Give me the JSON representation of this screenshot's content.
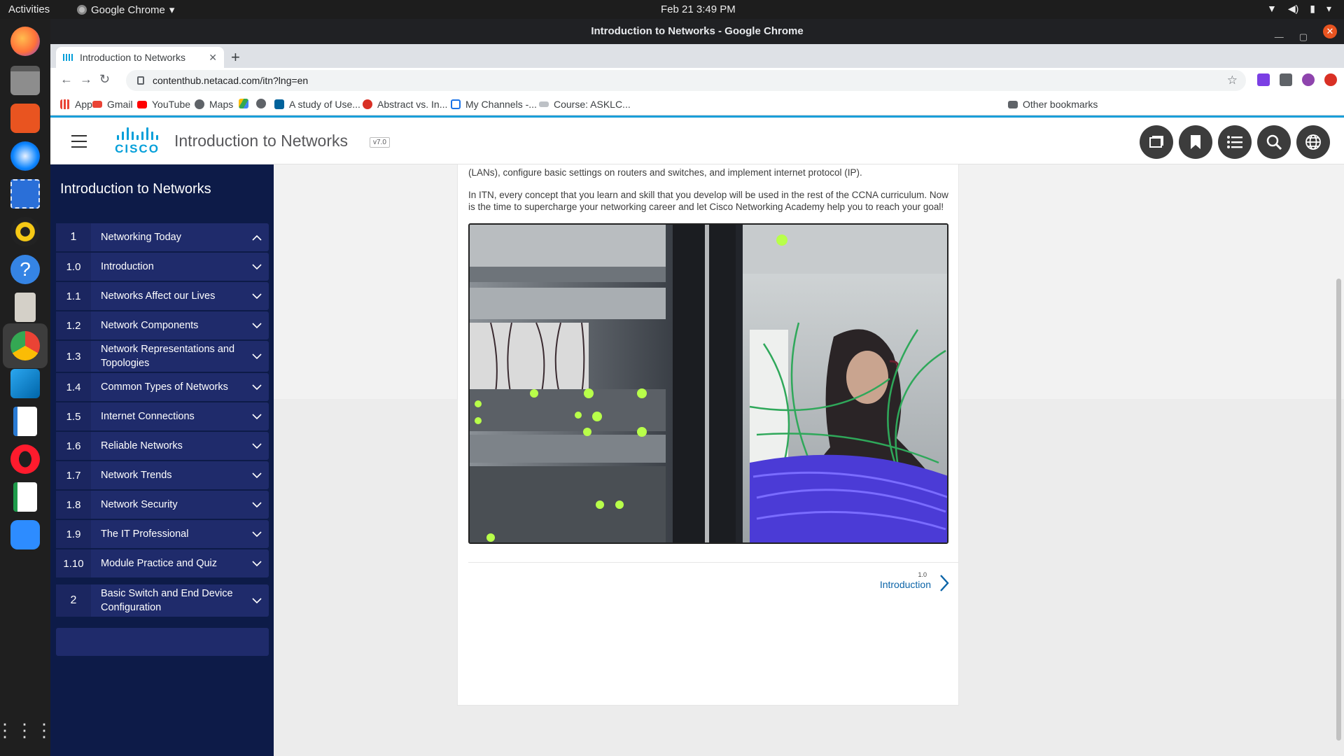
{
  "system": {
    "activities": "Activities",
    "app_menu": "Google Chrome",
    "clock": "Feb 21  3:49 PM"
  },
  "window": {
    "title": "Introduction to Networks - Google Chrome"
  },
  "browser": {
    "tab_title": "Introduction to Networks",
    "url": "contenthub.netacad.com/itn?lng=en",
    "bookmarks": [
      {
        "label": "Apps",
        "icon": "apps-grid-icon",
        "color": "#4285f4"
      },
      {
        "label": "Gmail",
        "icon": "gmail-icon",
        "color": "#ea4335"
      },
      {
        "label": "YouTube",
        "icon": "youtube-icon",
        "color": "#ff0000"
      },
      {
        "label": "Maps",
        "icon": "maps-icon",
        "color": "#5f6368"
      },
      {
        "label": "A study of Use...",
        "icon": "ieee-icon",
        "color": "#00629b"
      },
      {
        "label": "Abstract vs. In...",
        "icon": "scissors-icon",
        "color": "#d93025"
      },
      {
        "label": "My Channels -...",
        "icon": "chat-icon",
        "color": "#1a73e8"
      },
      {
        "label": "Course: ASKLC...",
        "icon": "course-icon",
        "color": "#9aa0a6"
      }
    ],
    "other_bookmarks": "Other bookmarks"
  },
  "site": {
    "course_title": "Introduction to Networks",
    "version": "v7.0",
    "logo_text": "CISCO",
    "header_icons": [
      "window-icon",
      "bookmark-icon",
      "list-icon",
      "search-icon",
      "globe-icon"
    ]
  },
  "sidebar": {
    "title": "Introduction to Networks",
    "items": [
      {
        "num": "1",
        "label": "Networking Today",
        "expanded": true
      },
      {
        "num": "1.0",
        "label": "Introduction"
      },
      {
        "num": "1.1",
        "label": "Networks Affect our Lives"
      },
      {
        "num": "1.2",
        "label": "Network Components"
      },
      {
        "num": "1.3",
        "label": "Network Representations and Topologies"
      },
      {
        "num": "1.4",
        "label": "Common Types of Networks"
      },
      {
        "num": "1.5",
        "label": "Internet Connections"
      },
      {
        "num": "1.6",
        "label": "Reliable Networks"
      },
      {
        "num": "1.7",
        "label": "Network Trends"
      },
      {
        "num": "1.8",
        "label": "Network Security"
      },
      {
        "num": "1.9",
        "label": "The IT Professional"
      },
      {
        "num": "1.10",
        "label": "Module Practice and Quiz"
      },
      {
        "num": "2",
        "label": "Basic Switch and End Device Configuration"
      }
    ]
  },
  "content": {
    "para1": "(LANs), configure basic settings on routers and switches, and implement internet protocol (IP).",
    "para2": "In ITN, every concept that you learn and skill that you develop will be used in the rest of the CCNA curriculum. Now is the time to supercharge your networking career and let Cisco Networking Academy help you to reach your goal!",
    "next_section_num": "1.0",
    "next_section_label": "Introduction"
  }
}
